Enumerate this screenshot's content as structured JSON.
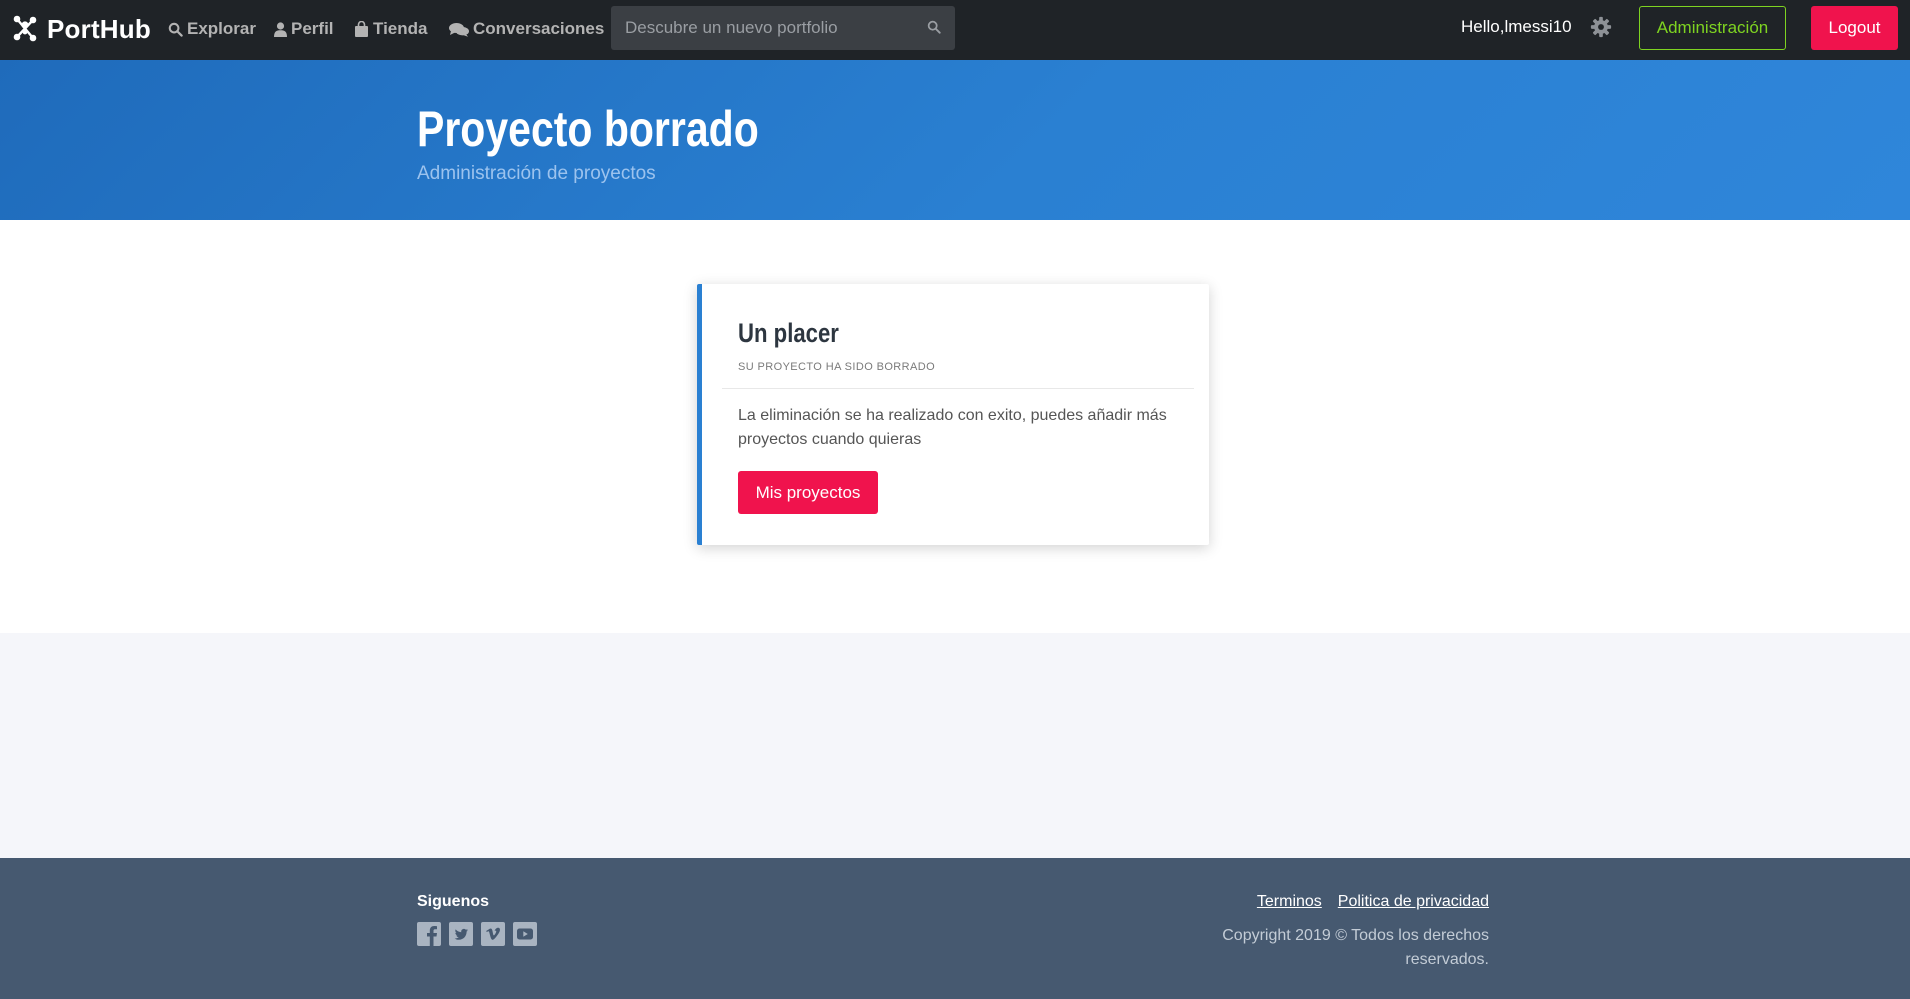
{
  "navbar": {
    "brand": "PortHub",
    "brand_icon": "network-nodes-icon",
    "items": [
      {
        "label": "Explorar",
        "icon": "search-icon"
      },
      {
        "label": "Perfil",
        "icon": "user-icon"
      },
      {
        "label": "Tienda",
        "icon": "shopping-bag-icon"
      },
      {
        "label": "Conversaciones",
        "icon": "chat-bubbles-icon"
      }
    ],
    "search_placeholder": "Descubre un nuevo portfolio",
    "greeting": "Hello,lmessi10",
    "admin_label": "Administración",
    "logout_label": "Logout"
  },
  "hero": {
    "title": "Proyecto borrado",
    "subtitle": "Administración de proyectos"
  },
  "card": {
    "title": "Un placer",
    "subtitle": "SU PROYECTO HA SIDO BORRADO",
    "body": "La eliminación se ha realizado con exito, puedes añadir más proyectos cuando quieras",
    "button_label": "Mis proyectos"
  },
  "footer": {
    "follow_label": "Siguenos",
    "socials": [
      "facebook-icon",
      "twitter-icon",
      "vimeo-icon",
      "youtube-icon"
    ],
    "links": [
      "Terminos",
      "Politica de privacidad"
    ],
    "copyright": "Copyright 2019 © Todos los derechos reservados."
  },
  "colors": {
    "navbar_bg": "#1f2327",
    "hero_bg": "#2a80d2",
    "accent_pink": "#f0134d",
    "accent_green": "#7ed321",
    "footer_bg": "#465970"
  }
}
